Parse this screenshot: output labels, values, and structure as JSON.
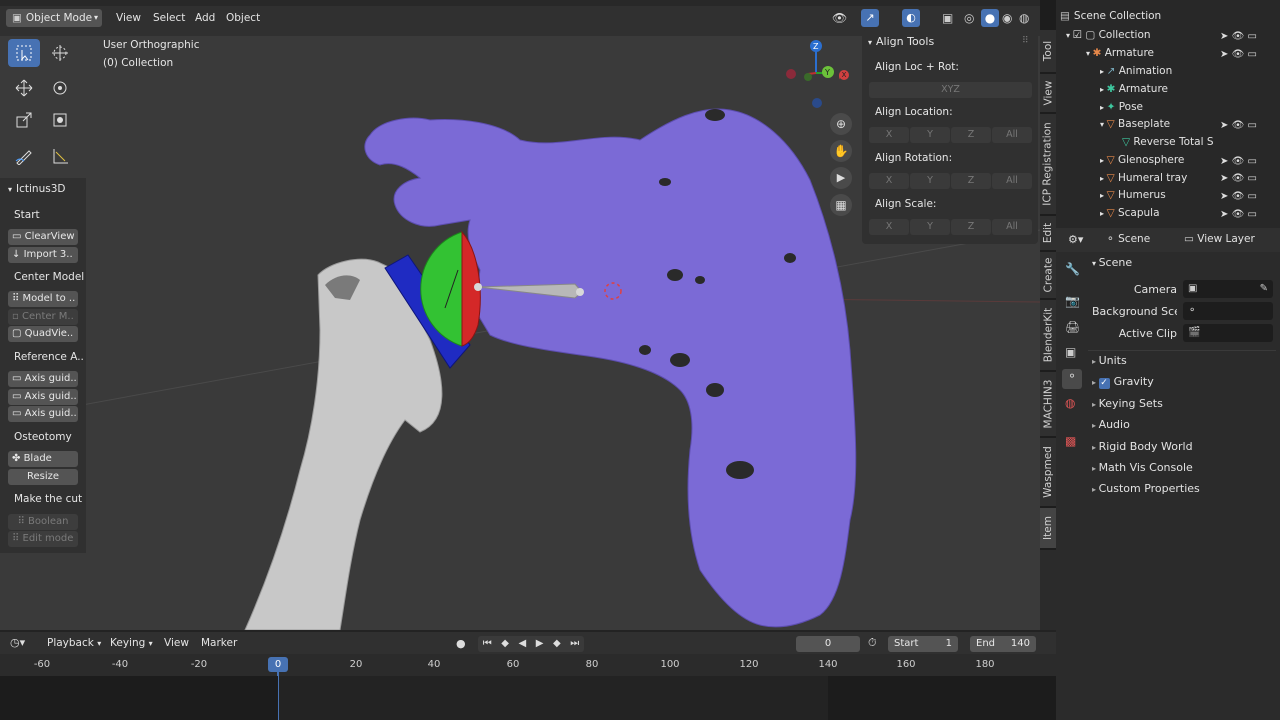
{
  "header": {
    "mode": "Object Mode",
    "menu": [
      "View",
      "Select",
      "Add",
      "Object"
    ]
  },
  "viewport": {
    "view_name": "User Orthographic",
    "collection_info": "(0) Collection",
    "gizmo_axes": {
      "z": "Z",
      "y": "Y",
      "x": "X"
    }
  },
  "sidebar_left": {
    "panel_title": "Ictinus3D",
    "sections": [
      {
        "label": "Start",
        "buttons": [
          {
            "label": "ClearView",
            "enabled": true
          },
          {
            "label": "Import 3..",
            "enabled": true
          }
        ]
      },
      {
        "label": "Center Model",
        "buttons": [
          {
            "label": "Model to ..",
            "enabled": true
          },
          {
            "label": "Center M..",
            "enabled": false
          },
          {
            "label": "QuadVie..",
            "enabled": true
          }
        ]
      },
      {
        "label": "Reference A..",
        "buttons": [
          {
            "label": "Axis guid..",
            "enabled": true
          },
          {
            "label": "Axis guid..",
            "enabled": true
          },
          {
            "label": "Axis guid..",
            "enabled": true
          }
        ]
      },
      {
        "label": "Osteotomy",
        "buttons": [
          {
            "label": "Blade",
            "enabled": true
          },
          {
            "label": "Resize",
            "enabled": true
          }
        ]
      },
      {
        "label": "Make the cut",
        "buttons": [
          {
            "label": "Boolean",
            "enabled": false
          },
          {
            "label": "Edit mode",
            "enabled": false
          }
        ]
      }
    ]
  },
  "align_tools": {
    "title": "Align Tools",
    "loc_rot_label": "Align Loc + Rot:",
    "loc_rot_button": "XYZ",
    "location_label": "Align Location:",
    "rotation_label": "Align Rotation:",
    "scale_label": "Align Scale:",
    "axis_buttons": [
      "X",
      "Y",
      "Z",
      "All"
    ]
  },
  "vertical_tabs": [
    "Tool",
    "View",
    "ICP Registration",
    "Edit",
    "Create",
    "BlenderKit",
    "MACHIN3",
    "Waspmed",
    "Item"
  ],
  "outliner": {
    "root": "Scene Collection",
    "items": [
      {
        "label": "Collection",
        "depth": 0
      },
      {
        "label": "Armature",
        "depth": 1
      },
      {
        "label": "Animation",
        "depth": 2
      },
      {
        "label": "Armature",
        "depth": 2
      },
      {
        "label": "Pose",
        "depth": 2
      },
      {
        "label": "Baseplate",
        "depth": 2
      },
      {
        "label": "Reverse Total S",
        "depth": 3
      },
      {
        "label": "Glenosphere",
        "depth": 2
      },
      {
        "label": "Humeral tray",
        "depth": 2
      },
      {
        "label": "Humerus",
        "depth": 2
      },
      {
        "label": "Scapula",
        "depth": 2
      }
    ]
  },
  "properties": {
    "scene_tab": "Scene",
    "view_layer_tab": "View Layer",
    "section_title": "Scene",
    "camera_label": "Camera",
    "background_label": "Background Sce..",
    "active_clip_label": "Active Clip",
    "subpanels": [
      "Units",
      "Gravity",
      "Keying Sets",
      "Audio",
      "Rigid Body World",
      "Math Vis Console",
      "Custom Properties"
    ],
    "gravity_checked": true
  },
  "timeline": {
    "menus": [
      "Playback",
      "Keying",
      "View",
      "Marker"
    ],
    "current_frame": "0",
    "start_label": "Start",
    "start_value": "1",
    "end_label": "End",
    "end_value": "140",
    "ruler": [
      "-60",
      "-40",
      "-20",
      "0",
      "20",
      "40",
      "60",
      "80",
      "100",
      "120",
      "140",
      "160",
      "180"
    ],
    "cursor_frame": "0"
  },
  "colors": {
    "scapula": "#7b6ad6",
    "humerus": "#c9c9c9",
    "glenosphere_green": "#33c233",
    "glenosphere_red": "#d42828",
    "baseplate_blue": "#1f2bc2",
    "accent": "#4772b3"
  }
}
